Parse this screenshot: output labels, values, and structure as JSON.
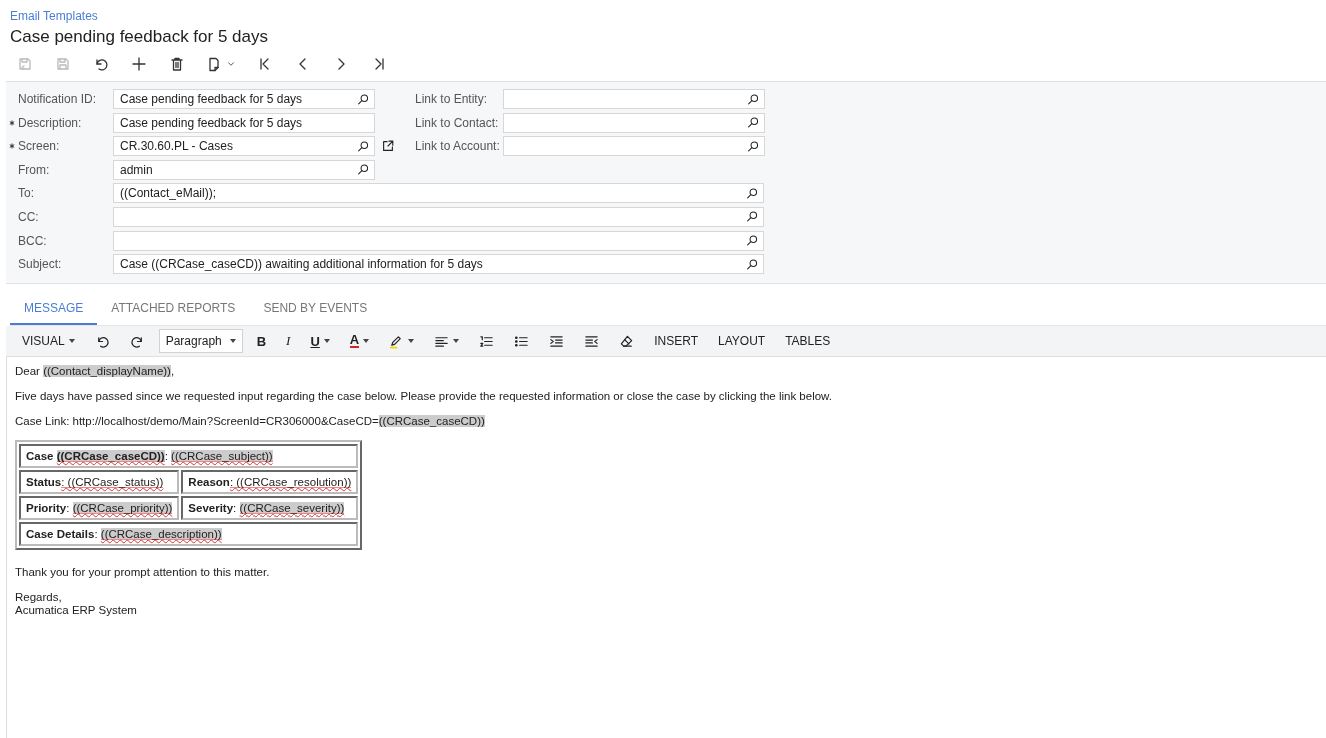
{
  "breadcrumb": "Email Templates",
  "title": "Case pending feedback for 5 days",
  "toolbar": [
    {
      "kind": "save-close",
      "disabled": true
    },
    {
      "kind": "save",
      "disabled": true
    },
    {
      "kind": "undo",
      "disabled": false
    },
    {
      "kind": "add",
      "disabled": false
    },
    {
      "kind": "delete",
      "disabled": false
    },
    {
      "kind": "copy",
      "disabled": false
    },
    {
      "kind": "first",
      "disabled": false
    },
    {
      "kind": "prev",
      "disabled": false
    },
    {
      "kind": "next",
      "disabled": false
    },
    {
      "kind": "last",
      "disabled": false
    }
  ],
  "form": {
    "left_fields": [
      {
        "label": "Notification ID:",
        "value": "Case pending feedback for 5 days",
        "required": false,
        "lookup": true,
        "open_link": false
      },
      {
        "label": "Description:",
        "value": "Case pending feedback for 5 days",
        "required": true,
        "lookup": false,
        "open_link": false
      },
      {
        "label": "Screen:",
        "value": "CR.30.60.PL - Cases",
        "required": true,
        "lookup": true,
        "open_link": true
      },
      {
        "label": "From:",
        "value": "admin",
        "required": false,
        "lookup": true,
        "open_link": false
      }
    ],
    "right_fields": [
      {
        "label": "Link to Entity:",
        "required": false,
        "lookup": true,
        "open_link": false
      },
      {
        "label": "Link to Contact:",
        "required": false,
        "lookup": true,
        "open_link": false
      },
      {
        "label": "Link to Account:",
        "required": false,
        "lookup": true,
        "open_link": false
      }
    ],
    "wide_fields": [
      {
        "label": "To:",
        "value": "((Contact_eMail));",
        "required": false,
        "lookup": true,
        "open_link": false
      },
      {
        "label": "CC:",
        "required": false,
        "lookup": true,
        "open_link": false
      },
      {
        "label": "BCC:",
        "required": false,
        "lookup": true,
        "open_link": false
      },
      {
        "label": "Subject:",
        "value": "Case ((CRCase_caseCD)) awaiting additional information for 5 days",
        "required": false,
        "lookup": true,
        "open_link": false
      }
    ]
  },
  "tabs": [
    {
      "label": "MESSAGE",
      "selected": true
    },
    {
      "label": "ATTACHED REPORTS",
      "selected": false
    },
    {
      "label": "SEND BY EVENTS",
      "selected": false
    }
  ],
  "editor_toolbar": [
    {
      "kind": "menu",
      "label": "VISUAL"
    },
    {
      "kind": "undo"
    },
    {
      "kind": "redo"
    },
    {
      "kind": "select",
      "label": "Paragraph"
    },
    {
      "kind": "bold",
      "label": "B"
    },
    {
      "kind": "italic",
      "label": "I"
    },
    {
      "kind": "underline",
      "label": "U"
    },
    {
      "kind": "font-color",
      "label": "A"
    },
    {
      "kind": "highlight"
    },
    {
      "kind": "align"
    },
    {
      "kind": "numbered-list"
    },
    {
      "kind": "bullet-list"
    },
    {
      "kind": "indent"
    },
    {
      "kind": "outdent"
    },
    {
      "kind": "eraser"
    },
    {
      "kind": "text",
      "label": "INSERT"
    },
    {
      "kind": "text",
      "label": "LAYOUT"
    },
    {
      "kind": "text",
      "label": "TABLES"
    }
  ],
  "body": [
    {
      "kind": "paragraph",
      "segments": [
        {
          "text": "Dear ",
          "bold": false,
          "highlight": false,
          "misspelled": false
        },
        {
          "text": "((Contact_displayName))",
          "bold": false,
          "highlight": true,
          "misspelled": false
        },
        {
          "text": ",",
          "bold": false,
          "highlight": false,
          "misspelled": false
        }
      ]
    },
    {
      "kind": "paragraph",
      "segments": [
        {
          "text": "Five days have passed since we requested input regarding the case below. Please provide the requested information or close the case by clicking the link below.",
          "bold": false,
          "highlight": false,
          "misspelled": false
        }
      ]
    },
    {
      "kind": "paragraph",
      "segments": [
        {
          "text": "Case Link: http://localhost/demo/Main?ScreenId=CR306000&CaseCD=",
          "bold": false,
          "highlight": false,
          "misspelled": false
        },
        {
          "text": "((CRCase_caseCD))",
          "bold": false,
          "highlight": true,
          "misspelled": false
        }
      ]
    },
    {
      "kind": "table",
      "rows": [
        {
          "cells": [
            {
              "colspan": 2,
              "segments": [
                {
                  "text": "Case ",
                  "bold": true,
                  "highlight": false,
                  "misspelled": false
                },
                {
                  "text": "((CRCase_caseCD))",
                  "bold": true,
                  "highlight": true,
                  "misspelled": true
                },
                {
                  "text": ": ",
                  "bold": false,
                  "highlight": false,
                  "misspelled": false
                },
                {
                  "text": "((CRCase_subject))",
                  "bold": false,
                  "highlight": true,
                  "misspelled": true
                }
              ]
            }
          ]
        },
        {
          "cells": [
            {
              "segments": [
                {
                  "text": "Status",
                  "bold": true,
                  "highlight": false,
                  "misspelled": false
                },
                {
                  "text": ": ((CRCase_status))",
                  "bold": false,
                  "highlight": false,
                  "misspelled": true
                }
              ]
            },
            {
              "segments": [
                {
                  "text": "Reason",
                  "bold": true,
                  "highlight": false,
                  "misspelled": false
                },
                {
                  "text": ": ((CRCase_resolution))",
                  "bold": false,
                  "highlight": false,
                  "misspelled": true
                }
              ]
            }
          ]
        },
        {
          "cells": [
            {
              "segments": [
                {
                  "text": "Priority",
                  "bold": true,
                  "highlight": false,
                  "misspelled": false
                },
                {
                  "text": ": ",
                  "bold": false,
                  "highlight": false,
                  "misspelled": false
                },
                {
                  "text": "((CRCase_priority))",
                  "bold": false,
                  "highlight": true,
                  "misspelled": true
                }
              ]
            },
            {
              "segments": [
                {
                  "text": "Severity",
                  "bold": true,
                  "highlight": false,
                  "misspelled": false
                },
                {
                  "text": ": ",
                  "bold": false,
                  "highlight": false,
                  "misspelled": false
                },
                {
                  "text": "((CRCase_severity))",
                  "bold": false,
                  "highlight": true,
                  "misspelled": true
                }
              ]
            }
          ]
        },
        {
          "cells": [
            {
              "colspan": 2,
              "segments": [
                {
                  "text": "Case Details",
                  "bold": true,
                  "highlight": false,
                  "misspelled": false
                },
                {
                  "text": ": ",
                  "bold": false,
                  "highlight": false,
                  "misspelled": false
                },
                {
                  "text": "((CRCase_description))",
                  "bold": false,
                  "highlight": true,
                  "misspelled": true
                }
              ]
            }
          ]
        }
      ]
    },
    {
      "kind": "paragraph",
      "segments": [
        {
          "text": "Thank you for your prompt attention to this matter.",
          "bold": false,
          "highlight": false,
          "misspelled": false
        }
      ]
    },
    {
      "kind": "signature",
      "lines": [
        "Regards,",
        "Acumatica ERP System"
      ]
    }
  ]
}
